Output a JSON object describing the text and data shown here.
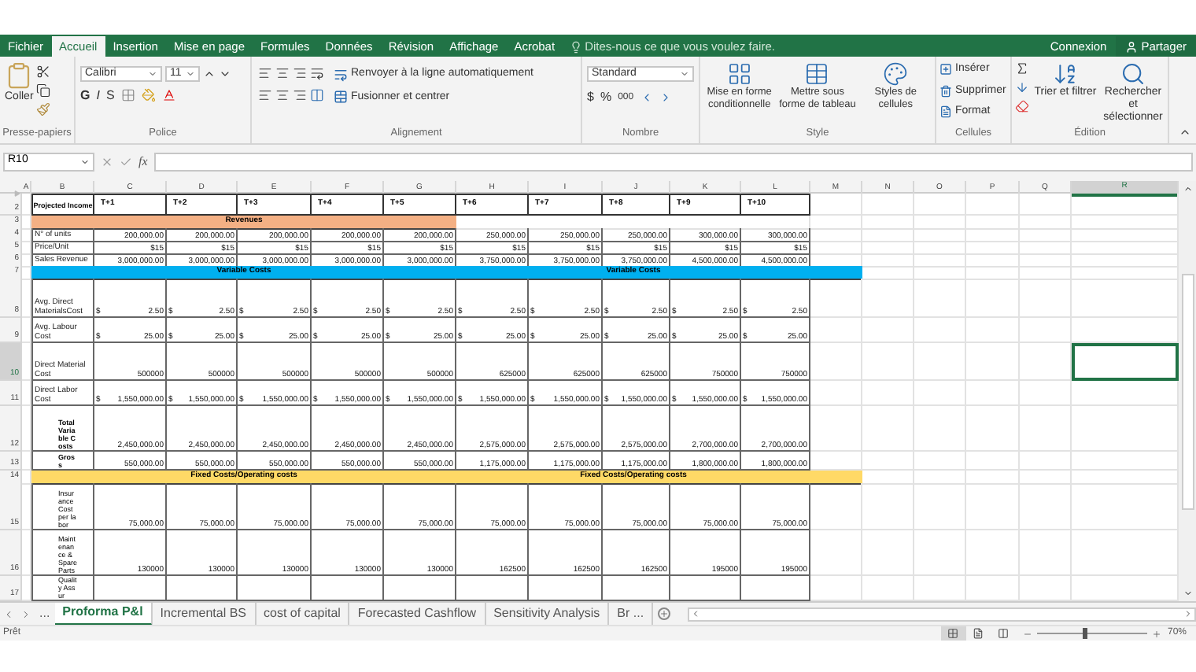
{
  "ribbon_tabs": [
    {
      "label": "Fichier",
      "selected": false
    },
    {
      "label": "Accueil",
      "selected": true
    },
    {
      "label": "Insertion",
      "selected": false
    },
    {
      "label": "Mise en page",
      "selected": false
    },
    {
      "label": "Formules",
      "selected": false
    },
    {
      "label": "Données",
      "selected": false
    },
    {
      "label": "Révision",
      "selected": false
    },
    {
      "label": "Affichage",
      "selected": false
    },
    {
      "label": "Acrobat",
      "selected": false
    }
  ],
  "tell_me": {
    "placeholder": "Dites-nous ce que vous voulez faire."
  },
  "account": {
    "sign_in": "Connexion",
    "share": "Partager"
  },
  "ribbon": {
    "clipboard": {
      "paste": "Coller",
      "label": "Presse-papiers"
    },
    "font": {
      "family": "Calibri",
      "size": "11",
      "bold": "G",
      "italic": "I",
      "underline": "S",
      "label": "Police"
    },
    "alignment": {
      "wrap": "Renvoyer à la ligne automatiquement",
      "merge": "Fusionner et centrer",
      "label": "Alignement"
    },
    "number": {
      "format": "Standard",
      "currency": "$",
      "percent": "%",
      "thousands": "000",
      "label": "Nombre"
    },
    "styles": {
      "buttons": [
        "Mise en forme conditionnelle",
        "Mettre sous forme de tableau",
        "Styles de cellules"
      ],
      "label": "Style"
    },
    "cells": {
      "buttons": [
        "Insérer",
        "Supprimer",
        "Format"
      ],
      "label": "Cellules"
    },
    "editing": {
      "buttons": [
        "Trier et filtrer",
        "Rechercher et sélectionner"
      ],
      "label": "Édition"
    }
  },
  "formula_bar": {
    "name_box": "R10",
    "fx": "fx"
  },
  "sheet": {
    "columns": [
      {
        "label": "A",
        "selected": false
      },
      {
        "label": "B",
        "selected": false
      },
      {
        "label": "C",
        "selected": false
      },
      {
        "label": "D",
        "selected": false
      },
      {
        "label": "E",
        "selected": false
      },
      {
        "label": "F",
        "selected": false
      },
      {
        "label": "G",
        "selected": false
      },
      {
        "label": "H",
        "selected": false
      },
      {
        "label": "I",
        "selected": false
      },
      {
        "label": "J",
        "selected": false
      },
      {
        "label": "K",
        "selected": false
      },
      {
        "label": "L",
        "selected": false
      },
      {
        "label": "M",
        "selected": false
      },
      {
        "label": "N",
        "selected": false
      },
      {
        "label": "O",
        "selected": false
      },
      {
        "label": "P",
        "selected": false
      },
      {
        "label": "Q",
        "selected": false
      },
      {
        "label": "R",
        "selected": true
      }
    ],
    "rows": [
      {
        "number": "2",
        "kind": "header",
        "selected": false,
        "label": "Projected Income",
        "cells": [
          "T+1",
          "T+2",
          "T+3",
          "T+4",
          "T+5",
          "T+6",
          "T+7",
          "T+8",
          "T+9",
          "T+10"
        ]
      },
      {
        "number": "3",
        "kind": "band",
        "selected": false,
        "segments": [
          {
            "label": "Revenues",
            "color": "#f4b084"
          }
        ]
      },
      {
        "number": "4",
        "kind": "data",
        "selected": false,
        "label": "N° of units",
        "cells": [
          "200,000.00",
          "200,000.00",
          "200,000.00",
          "200,000.00",
          "200,000.00",
          "250,000.00",
          "250,000.00",
          "250,000.00",
          "300,000.00",
          "300,000.00"
        ]
      },
      {
        "number": "5",
        "kind": "data",
        "selected": false,
        "label": "Price/Unit",
        "cells": [
          "$15",
          "$15",
          "$15",
          "$15",
          "$15",
          "$15",
          "$15",
          "$15",
          "$15",
          "$15"
        ]
      },
      {
        "number": "6",
        "kind": "data",
        "selected": false,
        "label": "Sales Revenue",
        "cells": [
          "3,000,000.00",
          "3,000,000.00",
          "3,000,000.00",
          "3,000,000.00",
          "3,000,000.00",
          "3,750,000.00",
          "3,750,000.00",
          "3,750,000.00",
          "4,500,000.00",
          "4,500,000.00"
        ]
      },
      {
        "number": "7",
        "kind": "band",
        "selected": false,
        "segments": [
          {
            "label": "Variable Costs",
            "color": "#00b0f0"
          },
          {
            "label": "Variable Costs",
            "color": "#00b0f0"
          },
          {
            "color": "#00b0f0"
          }
        ]
      },
      {
        "number": "8",
        "kind": "currency",
        "selected": false,
        "label": "Avg. Direct MaterialsCost",
        "cells": [
          {
            "symbol": "$",
            "value": "2.50"
          },
          {
            "symbol": "$",
            "value": "2.50"
          },
          {
            "symbol": "$",
            "value": "2.50"
          },
          {
            "symbol": "$",
            "value": "2.50"
          },
          {
            "symbol": "$",
            "value": "2.50"
          },
          {
            "symbol": "$",
            "value": "2.50"
          },
          {
            "symbol": "$",
            "value": "2.50"
          },
          {
            "symbol": "$",
            "value": "2.50"
          },
          {
            "symbol": "$",
            "value": "2.50"
          },
          {
            "symbol": "$",
            "value": "2.50"
          }
        ]
      },
      {
        "number": "9",
        "kind": "currency",
        "selected": false,
        "label": "Avg. Labour Cost",
        "cells": [
          {
            "symbol": "$",
            "value": "25.00"
          },
          {
            "symbol": "$",
            "value": "25.00"
          },
          {
            "symbol": "$",
            "value": "25.00"
          },
          {
            "symbol": "$",
            "value": "25.00"
          },
          {
            "symbol": "$",
            "value": "25.00"
          },
          {
            "symbol": "$",
            "value": "25.00"
          },
          {
            "symbol": "$",
            "value": "25.00"
          },
          {
            "symbol": "$",
            "value": "25.00"
          },
          {
            "symbol": "$",
            "value": "25.00"
          },
          {
            "symbol": "$",
            "value": "25.00"
          }
        ]
      },
      {
        "number": "10",
        "kind": "data",
        "selected": true,
        "label": "Direct Material Cost",
        "cells": [
          "500000",
          "500000",
          "500000",
          "500000",
          "500000",
          "625000",
          "625000",
          "625000",
          "750000",
          "750000"
        ]
      },
      {
        "number": "11",
        "kind": "currency",
        "selected": false,
        "label": "Direct Labor Cost",
        "cells": [
          {
            "symbol": "$",
            "value": "1,550,000.00"
          },
          {
            "symbol": "$",
            "value": "1,550,000.00"
          },
          {
            "symbol": "$",
            "value": "1,550,000.00"
          },
          {
            "symbol": "$",
            "value": "1,550,000.00"
          },
          {
            "symbol": "$",
            "value": "1,550,000.00"
          },
          {
            "symbol": "$",
            "value": "1,550,000.00"
          },
          {
            "symbol": "$",
            "value": "1,550,000.00"
          },
          {
            "symbol": "$",
            "value": "1,550,000.00"
          },
          {
            "symbol": "$",
            "value": "1,550,000.00"
          },
          {
            "symbol": "$",
            "value": "1,550,000.00"
          }
        ]
      },
      {
        "number": "12",
        "kind": "narrow",
        "bold": true,
        "selected": false,
        "label": "Total Variable Costs",
        "cells": [
          "2,450,000.00",
          "2,450,000.00",
          "2,450,000.00",
          "2,450,000.00",
          "2,450,000.00",
          "2,575,000.00",
          "2,575,000.00",
          "2,575,000.00",
          "2,700,000.00",
          "2,700,000.00"
        ]
      },
      {
        "number": "13",
        "kind": "narrow",
        "bold": true,
        "selected": false,
        "label": "Gross",
        "cells": [
          "550,000.00",
          "550,000.00",
          "550,000.00",
          "550,000.00",
          "550,000.00",
          "1,175,000.00",
          "1,175,000.00",
          "1,175,000.00",
          "1,800,000.00",
          "1,800,000.00"
        ]
      },
      {
        "number": "14",
        "kind": "band",
        "selected": false,
        "segments": [
          {
            "label": "Fixed Costs/Operating costs",
            "color": "#ffd966"
          },
          {
            "label": "Fixed Costs/Operating costs",
            "color": "#ffd966"
          },
          {
            "color": "#ffd966"
          }
        ]
      },
      {
        "number": "15",
        "kind": "narrow",
        "bold": false,
        "selected": false,
        "label": "Insurance Cost per labor",
        "cells": [
          "75,000.00",
          "75,000.00",
          "75,000.00",
          "75,000.00",
          "75,000.00",
          "75,000.00",
          "75,000.00",
          "75,000.00",
          "75,000.00",
          "75,000.00"
        ]
      },
      {
        "number": "16",
        "kind": "narrow",
        "bold": false,
        "selected": false,
        "label": "Maintenance & Spare Parts",
        "cells": [
          "130000",
          "130000",
          "130000",
          "130000",
          "130000",
          "162500",
          "162500",
          "162500",
          "195000",
          "195000"
        ]
      },
      {
        "number": "17",
        "kind": "narrow",
        "bold": false,
        "selected": false,
        "label": "Quality Assur",
        "cells": []
      }
    ]
  },
  "sheet_tabs": {
    "overflow": "...",
    "tabs": [
      {
        "label": "Proforma P&l",
        "selected": true
      },
      {
        "label": "Incremental BS",
        "selected": false
      },
      {
        "label": "cost of capital",
        "selected": false
      },
      {
        "label": "Forecasted Cashflow",
        "selected": false
      },
      {
        "label": "Sensitivity Analysis",
        "selected": false
      },
      {
        "label": "Br ...",
        "selected": false
      }
    ]
  },
  "status_bar": {
    "status": "Prêt",
    "views": [
      {
        "kind": "normal",
        "selected": true
      },
      {
        "kind": "page_layout",
        "selected": false
      },
      {
        "kind": "page_break",
        "selected": false
      }
    ],
    "zoom": {
      "level": 0.43,
      "reading": "70%"
    }
  }
}
